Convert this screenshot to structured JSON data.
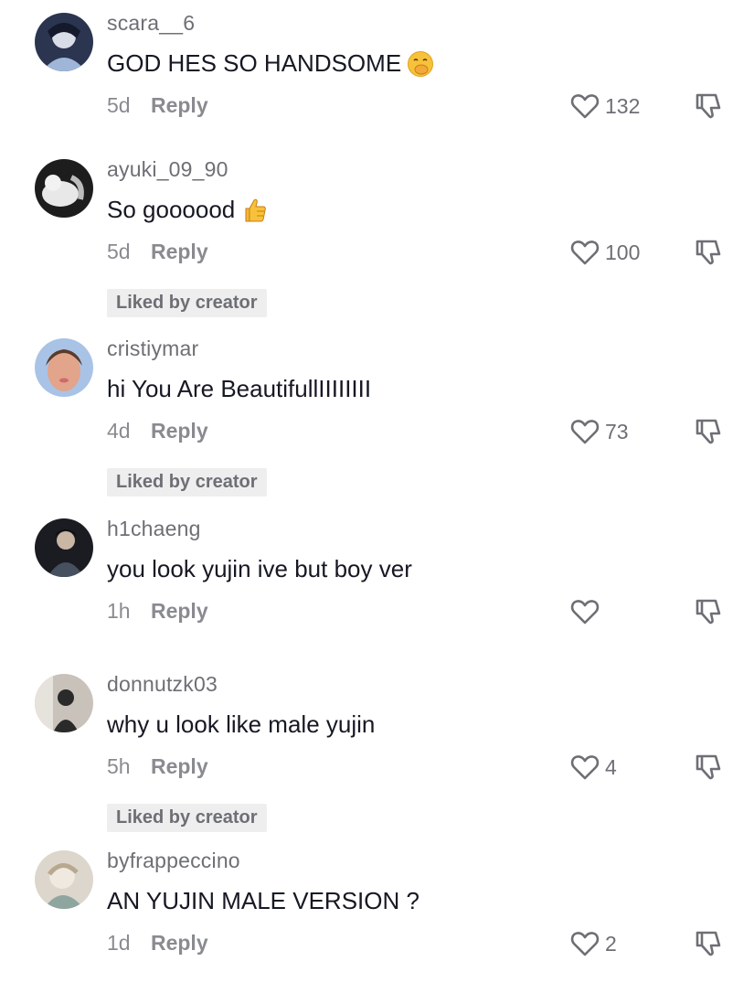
{
  "comments": [
    {
      "username": "scara__6",
      "text": "GOD HES SO HANDSOME",
      "emoji": "hand-over-mouth-emoji",
      "time": "5d",
      "reply_label": "Reply",
      "likes": "132",
      "liked_by_creator": false,
      "avatar_colors": [
        "#2b3550",
        "#9fb6d8"
      ]
    },
    {
      "username": "ayuki_09_90",
      "text": "So goooood",
      "emoji": "thumbs-up-emoji",
      "time": "5d",
      "reply_label": "Reply",
      "likes": "100",
      "liked_by_creator": true,
      "liked_label": "Liked by creator",
      "avatar_colors": [
        "#1d1d1d",
        "#e8e8e8"
      ]
    },
    {
      "username": "cristiymar",
      "text": "hi You Are BeautifullIIIIIIII",
      "emoji": "",
      "time": "4d",
      "reply_label": "Reply",
      "likes": "73",
      "liked_by_creator": true,
      "liked_label": "Liked by creator",
      "avatar_colors": [
        "#a9c3e6",
        "#e2a48a"
      ]
    },
    {
      "username": "h1chaeng",
      "text": "you look yujin ive but boy ver",
      "emoji": "",
      "time": "1h",
      "reply_label": "Reply",
      "likes": "",
      "liked_by_creator": false,
      "avatar_colors": [
        "#1a1c22",
        "#46505e"
      ]
    },
    {
      "username": "donnutzk03",
      "text": "why u look like male yujin",
      "emoji": "",
      "time": "5h",
      "reply_label": "Reply",
      "likes": "4",
      "liked_by_creator": true,
      "liked_label": "Liked by creator",
      "avatar_colors": [
        "#c8c2bb",
        "#2a2a2a"
      ]
    },
    {
      "username": "byfrappeccino",
      "text": "AN YUJIN MALE VERSION ?",
      "emoji": "",
      "time": "1d",
      "reply_label": "Reply",
      "likes": "2",
      "liked_by_creator": false,
      "avatar_colors": [
        "#dcd6cc",
        "#8fa6a0"
      ]
    }
  ],
  "colors": {
    "text": "#161823",
    "secondary": "#8a8b91",
    "username": "#6e6f75",
    "badge_bg": "#eeeeef"
  }
}
